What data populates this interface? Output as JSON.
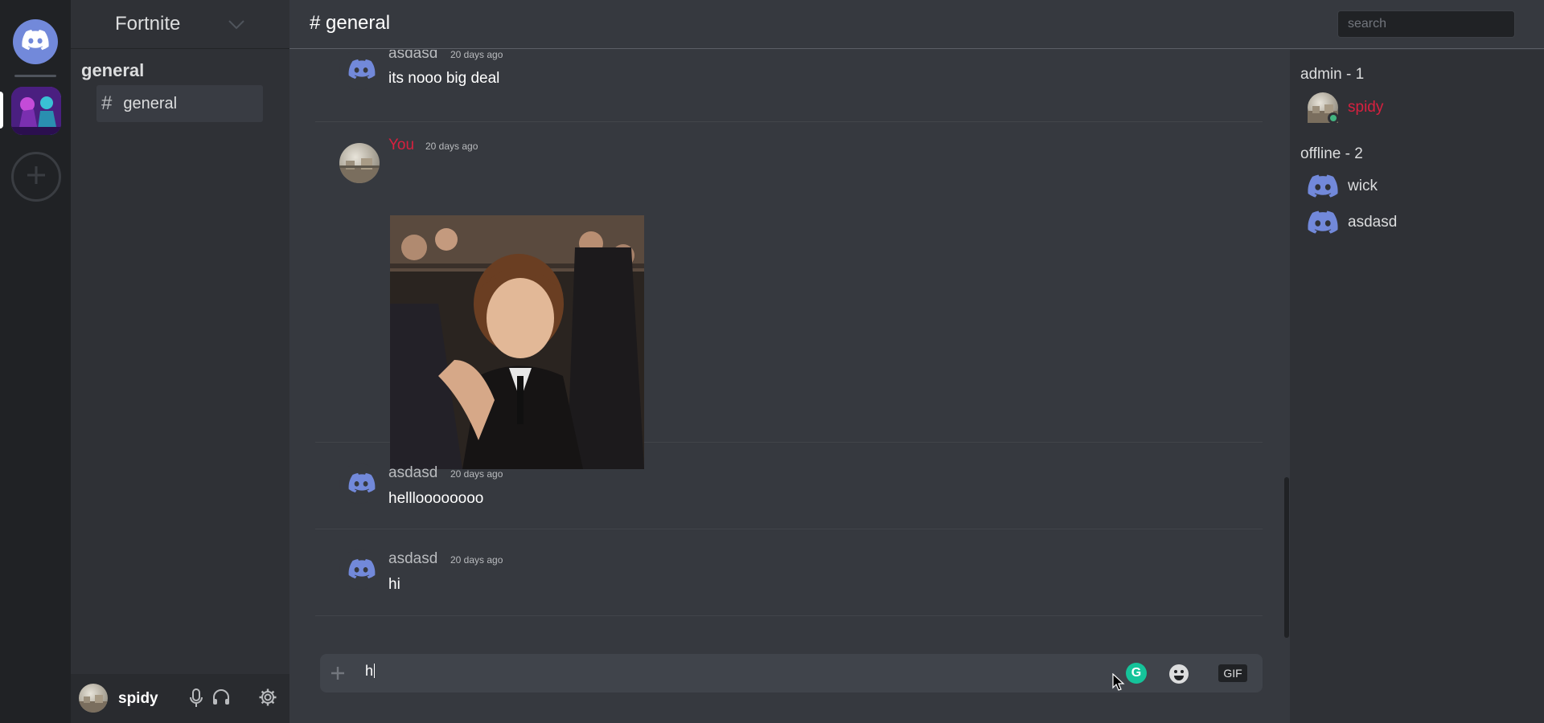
{
  "server": {
    "name": "Fortnite"
  },
  "sidebar": {
    "category": "general",
    "channels": [
      {
        "hash": "#",
        "name": "general"
      }
    ]
  },
  "header": {
    "channel_title": "# general",
    "search_placeholder": "search"
  },
  "messages": [
    {
      "author": "asdasd",
      "time": "20 days ago",
      "text": "its nooo big deal",
      "avatar": "discord-icon"
    },
    {
      "author": "You",
      "time": "20 days ago",
      "text": "",
      "attachment": "gif-image",
      "avatar": "user-photo"
    },
    {
      "author": "asdasd",
      "time": "20 days ago",
      "text": "hellloooooooo",
      "avatar": "discord-icon"
    },
    {
      "author": "asdasd",
      "time": "20 days ago",
      "text": "hi",
      "avatar": "discord-icon"
    }
  ],
  "composer": {
    "value": "h",
    "gif_label": "GIF",
    "grammarly_label": "G"
  },
  "user_panel": {
    "username": "spidy"
  },
  "members": {
    "groups": [
      {
        "title": "admin - 1",
        "members": [
          {
            "name": "spidy",
            "status": "online"
          }
        ]
      },
      {
        "title": "offline - 2",
        "members": [
          {
            "name": "wick"
          },
          {
            "name": "asdasd"
          }
        ]
      }
    ]
  },
  "colors": {
    "blurple": "#7289da",
    "admin_red": "#d8203f",
    "online_green": "#43b581"
  }
}
